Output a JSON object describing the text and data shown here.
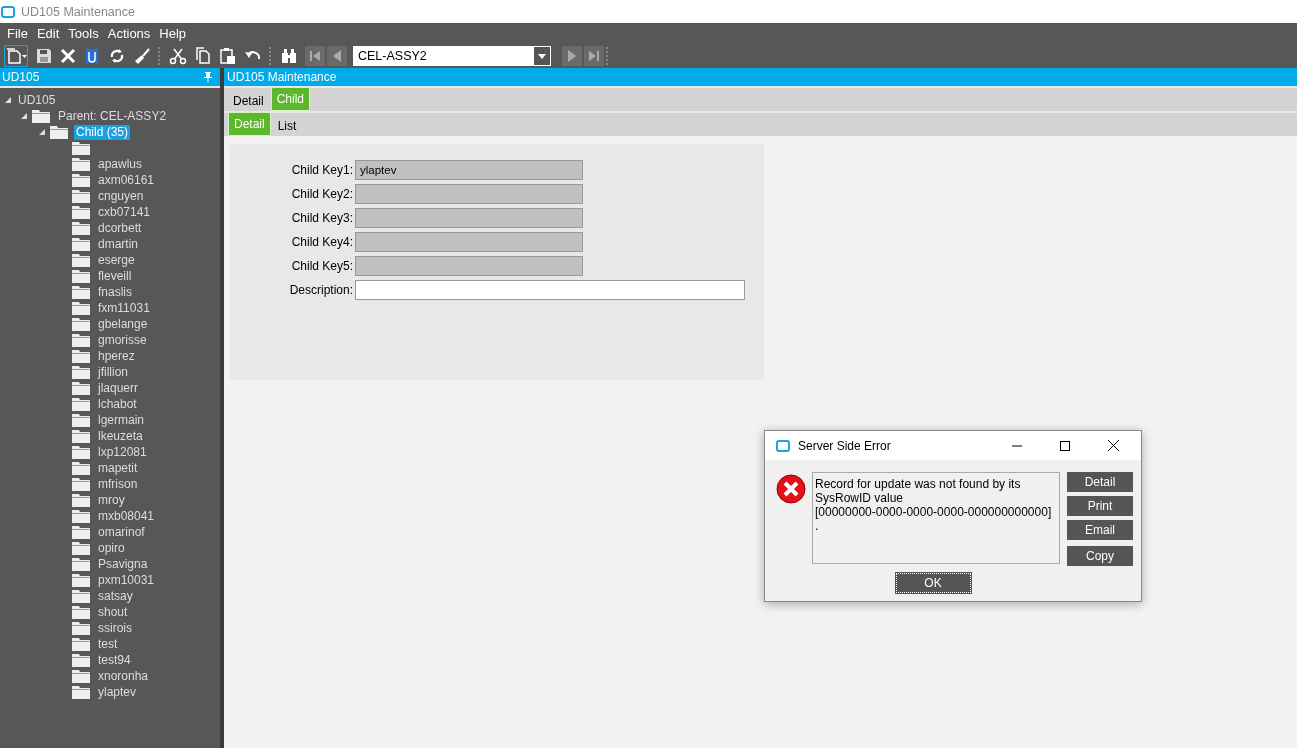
{
  "window": {
    "title": "UD105 Maintenance"
  },
  "menu": [
    "File",
    "Edit",
    "Tools",
    "Actions",
    "Help"
  ],
  "toolbar": {
    "combo_value": "CEL-ASSY2"
  },
  "tree_panel": {
    "title": "UD105"
  },
  "tree": [
    {
      "label": "UD105",
      "expanded": true,
      "selected": false,
      "children": [
        {
          "label": "Parent: CEL-ASSY2",
          "expanded": true,
          "selected": false,
          "children": [
            {
              "label": "Child (35)",
              "expanded": true,
              "selected": true,
              "children": [
                {
                  "selected": false
                },
                {
                  "label": "apawlus",
                  "selected": false
                },
                {
                  "label": "axm06161",
                  "selected": false
                },
                {
                  "label": "cnguyen",
                  "selected": false
                },
                {
                  "label": "cxb07141",
                  "selected": false
                },
                {
                  "label": "dcorbett",
                  "selected": false
                },
                {
                  "label": "dmartin",
                  "selected": false
                },
                {
                  "label": "eserge",
                  "selected": false
                },
                {
                  "label": "fleveill",
                  "selected": false
                },
                {
                  "label": "fnaslis",
                  "selected": false
                },
                {
                  "label": "fxm11031",
                  "selected": false
                },
                {
                  "label": "gbelange",
                  "selected": false
                },
                {
                  "label": "gmorisse",
                  "selected": false
                },
                {
                  "label": "hperez",
                  "selected": false
                },
                {
                  "label": "jfillion",
                  "selected": false
                },
                {
                  "label": "jlaquerr",
                  "selected": false
                },
                {
                  "label": "lchabot",
                  "selected": false
                },
                {
                  "label": "lgermain",
                  "selected": false
                },
                {
                  "label": "lkeuzeta",
                  "selected": false
                },
                {
                  "label": "lxp12081",
                  "selected": false
                },
                {
                  "label": "mapetit",
                  "selected": false
                },
                {
                  "label": "mfrison",
                  "selected": false
                },
                {
                  "label": "mroy",
                  "selected": false
                },
                {
                  "label": "mxb08041",
                  "selected": false
                },
                {
                  "label": "omarinof",
                  "selected": false
                },
                {
                  "label": "opiro",
                  "selected": false
                },
                {
                  "label": "Psavigna",
                  "selected": false
                },
                {
                  "label": "pxm10031",
                  "selected": false
                },
                {
                  "label": "satsay",
                  "selected": false
                },
                {
                  "label": "shout",
                  "selected": false
                },
                {
                  "label": "ssirois",
                  "selected": false
                },
                {
                  "label": "test",
                  "selected": false
                },
                {
                  "label": "test94",
                  "selected": false
                },
                {
                  "label": "xnoronha",
                  "selected": false
                },
                {
                  "label": "ylaptev",
                  "selected": false
                }
              ]
            }
          ]
        }
      ]
    }
  ],
  "main_panel": {
    "title": "UD105 Maintenance"
  },
  "tabs": [
    {
      "label": "Detail",
      "selected": false
    },
    {
      "label": "Child",
      "selected": true
    }
  ],
  "subtabs": [
    {
      "label": "Detail",
      "selected": true
    },
    {
      "label": "List",
      "selected": false
    }
  ],
  "fields": [
    {
      "label": "Child Key1:",
      "value": "ylaptev",
      "kind": "readonly"
    },
    {
      "label": "Child Key2:",
      "kind": "readonly"
    },
    {
      "label": "Child Key3:",
      "kind": "readonly"
    },
    {
      "label": "Child Key4:",
      "kind": "readonly"
    },
    {
      "label": "Child Key5:",
      "kind": "readonly"
    },
    {
      "label": "Description:",
      "kind": "editable"
    }
  ],
  "dialog": {
    "title": "Server Side Error",
    "message": "Record for update was not found by its\nSysRowID value\n[00000000-0000-0000-0000-000000000000]\n.",
    "buttons": [
      "Detail",
      "Print",
      "Email",
      "Copy"
    ],
    "ok": "OK"
  }
}
